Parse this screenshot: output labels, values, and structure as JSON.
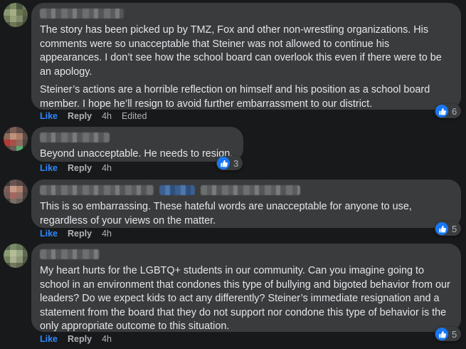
{
  "accent_color": "#2d88ff",
  "comments": [
    {
      "paragraphs": [
        "The story has been picked up by TMZ, Fox and other non-wrestling organizations. His comments were so unacceptable that Steiner was not allowed to continue his appearances. I don’t see how the school board can overlook this even if there were to be an apology.",
        "Steiner’s actions are a horrible reflection on himself and his position as a school board member. I hope he’ll resign to avoid further embarrassment to our district."
      ],
      "like_label": "Like",
      "reply_label": "Reply",
      "time": "4h",
      "edited": "Edited",
      "reaction_icon": "like-icon",
      "reaction_count": "6"
    },
    {
      "paragraphs": [
        "Beyond unacceptable. He needs to resign."
      ],
      "like_label": "Like",
      "reply_label": "Reply",
      "time": "4h",
      "reaction_icon": "like-icon",
      "reaction_count": "3"
    },
    {
      "paragraphs": [
        "This is so embarrassing. These hateful words are unacceptable for anyone to use, regardless of your views on the matter."
      ],
      "like_label": "Like",
      "reply_label": "Reply",
      "time": "4h",
      "reaction_icon": "like-icon",
      "reaction_count": "5"
    },
    {
      "paragraphs": [
        "My heart hurts for the LGBTQ+ students in our community. Can you imagine going to school in an environment that condones this type of bullying and bigoted behavior from our leaders? Do we expect kids to act any differently? Steiner’s immediate resignation and a statement from the board that they do not support nor condone this type of behavior is the only appropriate outcome to this situation."
      ],
      "like_label": "Like",
      "reply_label": "Reply",
      "time": "4h",
      "reaction_icon": "like-icon",
      "reaction_count": "5"
    }
  ]
}
